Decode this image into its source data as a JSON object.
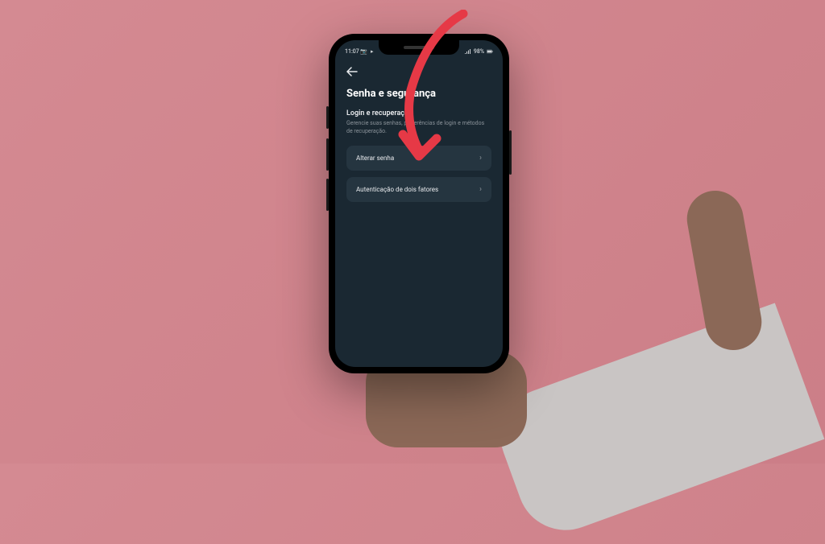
{
  "status_bar": {
    "time": "11:07",
    "battery_percent": "98%"
  },
  "header": {
    "title": "Senha e segurança"
  },
  "section": {
    "title": "Login e recuperação",
    "description": "Gerencie suas senhas, preferências de login e métodos de recuperação."
  },
  "items": [
    {
      "label": "Alterar senha"
    },
    {
      "label": "Autenticação de dois fatores"
    }
  ],
  "annotation": {
    "arrow_color": "#e63946"
  }
}
